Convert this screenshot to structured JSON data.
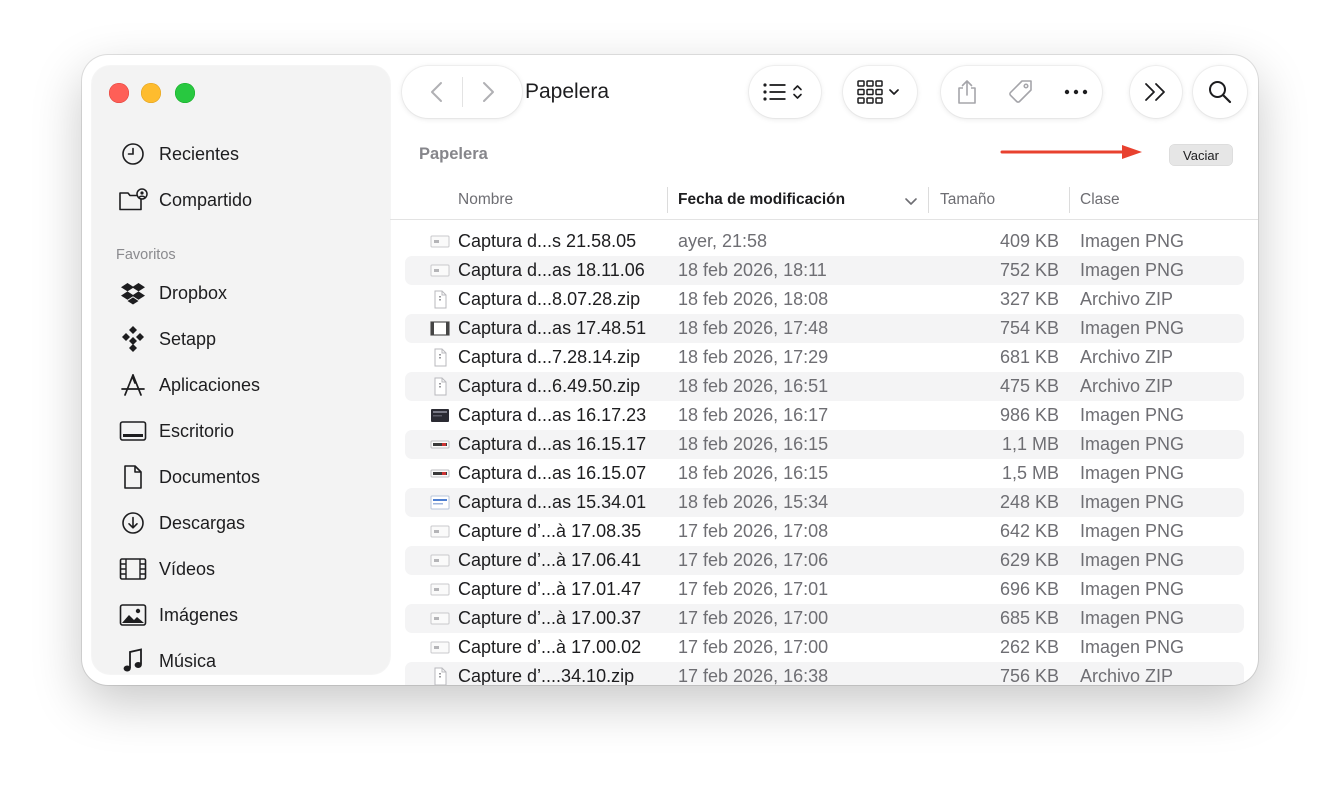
{
  "window": {
    "title": "Papelera"
  },
  "sidebar": {
    "top_items": [
      {
        "label": "Recientes",
        "icon": "clock-icon"
      },
      {
        "label": "Compartido",
        "icon": "shared-folder-icon"
      }
    ],
    "section_label": "Favoritos",
    "favorites": [
      {
        "label": "Dropbox",
        "icon": "dropbox-icon"
      },
      {
        "label": "Setapp",
        "icon": "setapp-icon"
      },
      {
        "label": "Aplicaciones",
        "icon": "applications-icon"
      },
      {
        "label": "Escritorio",
        "icon": "desktop-icon"
      },
      {
        "label": "Documentos",
        "icon": "document-icon"
      },
      {
        "label": "Descargas",
        "icon": "download-icon"
      },
      {
        "label": "Vídeos",
        "icon": "film-icon"
      },
      {
        "label": "Imágenes",
        "icon": "photo-icon"
      },
      {
        "label": "Música",
        "icon": "music-note-icon"
      }
    ]
  },
  "toolbar": {
    "back_icon": "chevron-left-icon",
    "forward_icon": "chevron-right-icon",
    "view_icon": "list-view-icon",
    "group_icon": "grid-group-icon",
    "share_icon": "share-icon",
    "tag_icon": "tag-icon",
    "more_icon": "ellipsis-icon",
    "overflow_icon": "double-chevron-icon",
    "search_icon": "search-icon"
  },
  "content": {
    "section_title": "Papelera",
    "empty_button_label": "Vaciar",
    "columns": {
      "name": "Nombre",
      "date": "Fecha de modificación",
      "size": "Tamaño",
      "kind": "Clase"
    },
    "files": [
      {
        "name": "Captura d...s 21.58.05",
        "date": "ayer, 21:58",
        "size": "409 KB",
        "kind": "Imagen PNG",
        "thumb": "png"
      },
      {
        "name": "Captura d...as 18.11.06",
        "date": "18 feb 2026, 18:11",
        "size": "752 KB",
        "kind": "Imagen PNG",
        "thumb": "png"
      },
      {
        "name": "Captura d...8.07.28.zip",
        "date": "18 feb 2026, 18:08",
        "size": "327 KB",
        "kind": "Archivo ZIP",
        "thumb": "zip"
      },
      {
        "name": "Captura d...as 17.48.51",
        "date": "18 feb 2026, 17:48",
        "size": "754 KB",
        "kind": "Imagen PNG",
        "thumb": "png-film"
      },
      {
        "name": "Captura d...7.28.14.zip",
        "date": "18 feb 2026, 17:29",
        "size": "681 KB",
        "kind": "Archivo ZIP",
        "thumb": "zip"
      },
      {
        "name": "Captura d...6.49.50.zip",
        "date": "18 feb 2026, 16:51",
        "size": "475 KB",
        "kind": "Archivo ZIP",
        "thumb": "zip"
      },
      {
        "name": "Captura d...as 16.17.23",
        "date": "18 feb 2026, 16:17",
        "size": "986 KB",
        "kind": "Imagen PNG",
        "thumb": "png-dark"
      },
      {
        "name": "Captura d...as 16.15.17",
        "date": "18 feb 2026, 16:15",
        "size": "1,1 MB",
        "kind": "Imagen PNG",
        "thumb": "png-strip"
      },
      {
        "name": "Captura d...as 16.15.07",
        "date": "18 feb 2026, 16:15",
        "size": "1,5 MB",
        "kind": "Imagen PNG",
        "thumb": "png-strip"
      },
      {
        "name": "Captura d...as 15.34.01",
        "date": "18 feb 2026, 15:34",
        "size": "248 KB",
        "kind": "Imagen PNG",
        "thumb": "png-blue"
      },
      {
        "name": "Capture d’...à 17.08.35",
        "date": "17 feb 2026, 17:08",
        "size": "642 KB",
        "kind": "Imagen PNG",
        "thumb": "png"
      },
      {
        "name": "Capture d’...à 17.06.41",
        "date": "17 feb 2026, 17:06",
        "size": "629 KB",
        "kind": "Imagen PNG",
        "thumb": "png"
      },
      {
        "name": "Capture d’...à 17.01.47",
        "date": "17 feb 2026, 17:01",
        "size": "696 KB",
        "kind": "Imagen PNG",
        "thumb": "png"
      },
      {
        "name": "Capture d’...à 17.00.37",
        "date": "17 feb 2026, 17:00",
        "size": "685 KB",
        "kind": "Imagen PNG",
        "thumb": "png"
      },
      {
        "name": "Capture d’...à 17.00.02",
        "date": "17 feb 2026, 17:00",
        "size": "262 KB",
        "kind": "Imagen PNG",
        "thumb": "png"
      },
      {
        "name": "Capture d’....34.10.zip",
        "date": "17 feb 2026, 16:38",
        "size": "756 KB",
        "kind": "Archivo ZIP",
        "thumb": "zip"
      }
    ]
  },
  "colors": {
    "traffic_red": "#fe5f57",
    "traffic_yellow": "#febc2e",
    "traffic_green": "#28c840",
    "annotation_arrow": "#e8412f",
    "row_stripe": "#f4f4f5"
  }
}
